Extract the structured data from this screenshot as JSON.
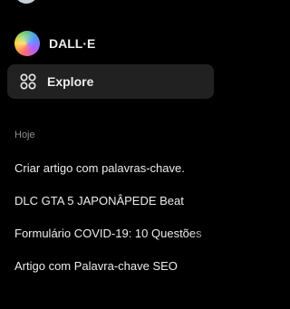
{
  "nav": {
    "dalle_label": "DALL·E",
    "explore_label": "Explore",
    "explore_icon": "grid-icon"
  },
  "history": {
    "section_header": "Hoje",
    "items": [
      {
        "label": "Criar artigo com palavras-chave."
      },
      {
        "label": "DLC GTA 5 JAPONÂPEDE Beat"
      },
      {
        "label": "Formulário COVID-19: 10 Questões"
      },
      {
        "label": "Artigo com Palavra-chave SEO"
      }
    ]
  },
  "colors": {
    "background": "#000000",
    "active_item": "#212121",
    "text": "#ececec",
    "muted_text": "#8e8e8e"
  }
}
